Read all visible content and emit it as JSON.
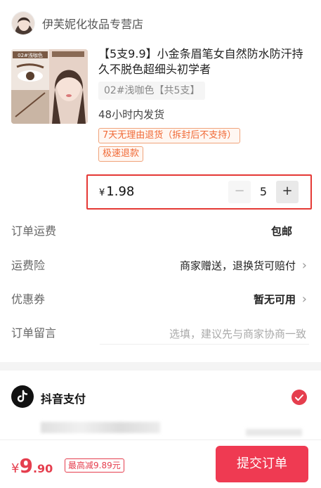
{
  "store": {
    "name": "伊芙妮化妆品专营店"
  },
  "product": {
    "title": "【5支9.9】小金条眉笔女自然防水防汗持久不脱色超细头初学者",
    "variant": "02#浅咖色【共5支】",
    "shipping": "48小时内发货",
    "tags": [
      "7天无理由退货（拆封后不支持）",
      "极速退款"
    ],
    "price_currency": "¥",
    "price": "1.98",
    "quantity": "5"
  },
  "rows": {
    "shipping_fee": {
      "label": "订单运费",
      "value": "包邮"
    },
    "insurance": {
      "label": "运费险",
      "value": "商家赠送，退换货可赔付"
    },
    "coupon": {
      "label": "优惠券",
      "value": "暂无可用"
    },
    "remark": {
      "label": "订单留言",
      "placeholder": "选填，建议先与商家协商一致"
    }
  },
  "payment": {
    "label": "抖音支付"
  },
  "footer": {
    "currency": "¥",
    "total_int": "9",
    "total_dec": ".90",
    "discount": "最高减9.89元",
    "submit": "提交订单"
  },
  "colors": {
    "accent": "#ef3a52",
    "tag": "#f06a37",
    "highlight_border": "#e53935"
  }
}
